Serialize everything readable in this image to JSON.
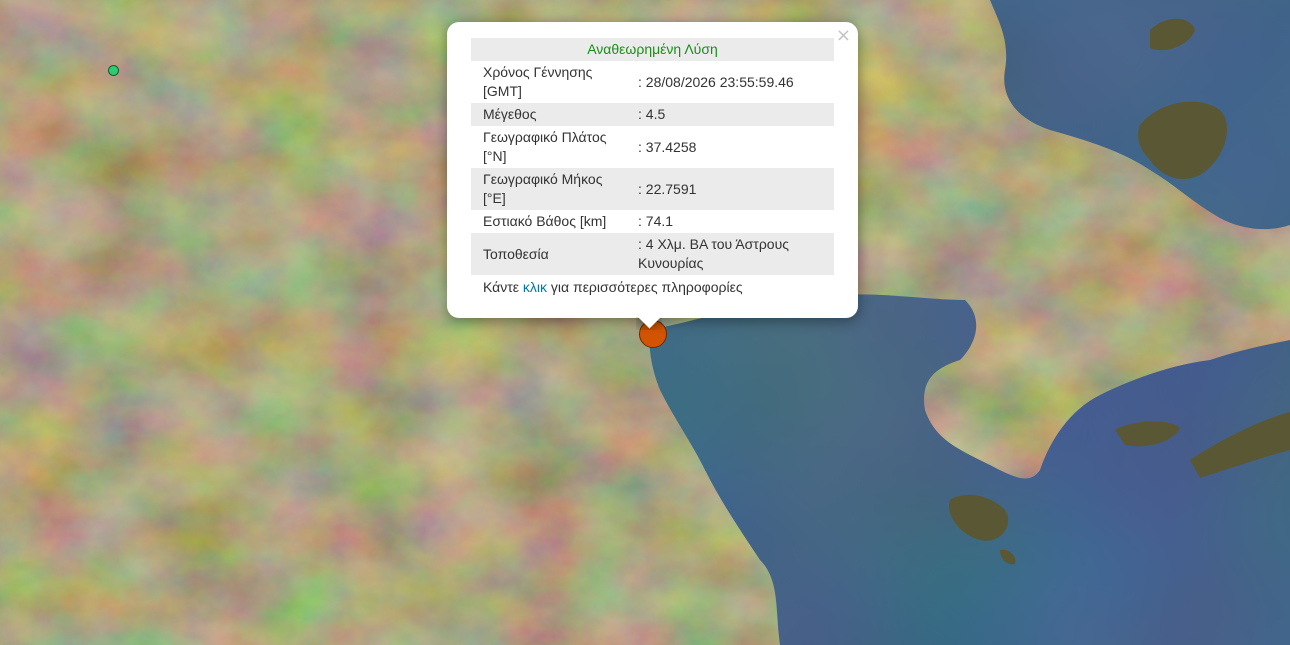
{
  "popup": {
    "title": "Αναθεωρημένη Λύση",
    "close_symbol": "×",
    "rows": [
      {
        "label": "Χρόνος Γέννησης [GMT]",
        "value": ": 28/08/2026 23:55:59.46"
      },
      {
        "label": "Μέγεθος",
        "value": ": 4.5"
      },
      {
        "label": "Γεωγραφικό Πλάτος [°N]",
        "value": ": 37.4258"
      },
      {
        "label": "Γεωγραφικό Μήκος [°E]",
        "value": ": 22.7591"
      },
      {
        "label": "Εστιακό Βάθος [km]",
        "value": ": 74.1"
      },
      {
        "label": "Τοποθεσία",
        "value": ": 4 Χλμ. ΒΑ του Άστρους Κυνουρίας"
      }
    ],
    "more_prefix": "Κάντε ",
    "more_link": "κλικ",
    "more_suffix": " για περισσότερες πληροφορίες"
  },
  "markers": {
    "main_color": "#d35400",
    "secondary_color": "#2ecc71"
  },
  "map": {
    "land_color": "#5c5a36",
    "sea_color": "#0f2540"
  }
}
